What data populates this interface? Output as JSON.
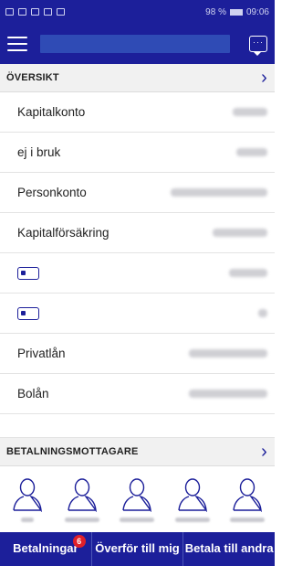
{
  "status_bar": {
    "battery": "98 %",
    "time": "09:06"
  },
  "header": {
    "menu_icon": "hamburger-icon",
    "chat_icon": "chat-icon",
    "chat_dots": "···"
  },
  "overview": {
    "title": "ÖVERSIKT",
    "chevron": "›",
    "accounts": [
      {
        "label": "Kapitalkonto"
      },
      {
        "label": "ej i bruk"
      },
      {
        "label": "Personkonto"
      },
      {
        "label": "Kapitalförsäkring"
      },
      {
        "label": "",
        "icon": "card-icon"
      },
      {
        "label": "",
        "icon": "card-icon"
      },
      {
        "label": "Privatlån"
      },
      {
        "label": "Bolån"
      }
    ]
  },
  "payees": {
    "title": "BETALNINGSMOTTAGARE",
    "chevron": "›",
    "icon": "person-outline-icon"
  },
  "bottom_nav": {
    "payments_label": "Betalningar",
    "payments_badge": "6",
    "transfer_label": "Överför till mig",
    "pay_others_label": "Betala till andra"
  },
  "colors": {
    "brand": "#1c1f9a",
    "badge": "#e0202a"
  }
}
